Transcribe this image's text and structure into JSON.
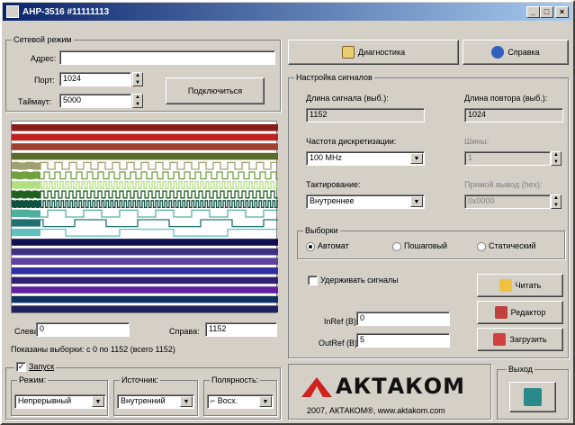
{
  "window": {
    "title": "АНР-3516 #11111113",
    "min": "_",
    "max": "□",
    "close": "×"
  },
  "network": {
    "group": "Сетевой режим",
    "addr_label": "Адрес:",
    "addr_value": "",
    "port_label": "Порт:",
    "port_value": "1024",
    "timeout_label": "Таймаут:",
    "timeout_value": "5000",
    "connect": "Подключиться"
  },
  "view": {
    "left_label": "Слева:",
    "left_value": "0",
    "right_label": "Справа:",
    "right_value": "1152",
    "status": "Показаны выборки: с 0 по 1152 (всего 1152)"
  },
  "toolbar": {
    "diag": "Диагностика",
    "help": "Справка"
  },
  "signals": {
    "group": "Настройка сигналов",
    "len_label": "Длина сигнала (выб.):",
    "len_value": "1152",
    "rep_label": "Длина повтора (выб.):",
    "rep_value": "1024",
    "freq_label": "Частота дискретизации:",
    "freq_value": "100 MHz",
    "bus_label": "Шины:",
    "bus_value": "1",
    "clock_label": "Тактирование:",
    "clock_value": "Внутреннее",
    "direct_label": "Прямой вывод (hex):",
    "direct_value": "0x0000"
  },
  "samples": {
    "group": "Выборки",
    "opt1": "Автомат",
    "opt2": "Пошаговый",
    "opt3": "Статический"
  },
  "hold": {
    "label": "Удерживать сигналы",
    "inref_label": "InRef (В):",
    "inref_value": "0",
    "outref_label": "OutRef (В):",
    "outref_value": "5",
    "read": "Читать",
    "editor": "Редактор",
    "load": "Загрузить"
  },
  "launch": {
    "group": "Запуск",
    "mode_label": "Режим:",
    "mode_value": "Непрерывный",
    "source_label": "Источник:",
    "source_value": "Внутренний",
    "polarity_label": "Полярность:",
    "polarity_value": "Восх."
  },
  "brand": {
    "logo": "АКТАКОМ",
    "footer": "2007, АКТАКОМ®, www.aktakom.com"
  },
  "exit": {
    "group": "Выход"
  },
  "colors": {
    "accent": "#0a246a"
  },
  "icons": [
    "app-icon",
    "diagnostics-icon",
    "help-icon",
    "read-icon",
    "editor-icon",
    "load-icon",
    "exit-icon"
  ],
  "channel_colors": [
    "#8b1a1a",
    "#c02020",
    "#a04030",
    "#5a6a2a",
    "#a0a070",
    "#70a040",
    "#b0e080",
    "#206020",
    "#105040",
    "#50b0a0",
    "#207070",
    "#60c0c0",
    "#101050",
    "#403080",
    "#6040a0",
    "#3030a0",
    "#302070",
    "#6020a0",
    "#103060",
    "#202060"
  ]
}
